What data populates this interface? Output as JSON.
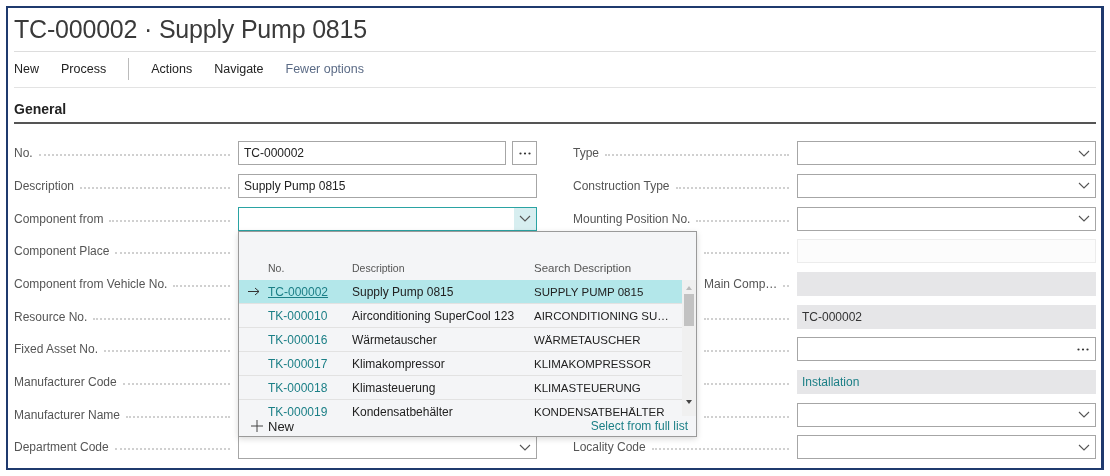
{
  "title": "TC-000002 · Supply Pump 0815",
  "toolbar": [
    {
      "kind": "menu",
      "label": "New"
    },
    {
      "kind": "menu",
      "label": "Process"
    },
    {
      "kind": "separator"
    },
    {
      "kind": "menu",
      "label": "Actions"
    },
    {
      "kind": "menu",
      "label": "Navigate"
    },
    {
      "kind": "toggle",
      "label": "Fewer options"
    }
  ],
  "section": "General",
  "left_fields": [
    {
      "label": "No.",
      "kind": "lookup",
      "value": "TC-000002"
    },
    {
      "label": "Description",
      "kind": "text",
      "value": "Supply Pump 0815"
    },
    {
      "label": "Component from",
      "kind": "select",
      "focused": true
    },
    {
      "label": "Component Place"
    },
    {
      "label": "Component from Vehicle No."
    },
    {
      "label": "Resource No."
    },
    {
      "label": "Fixed Asset No."
    },
    {
      "label": "Manufacturer Code"
    },
    {
      "label": "Manufacturer Name"
    },
    {
      "label": "Department Code",
      "kind": "select",
      "focused": false
    }
  ],
  "right_fields": [
    {
      "label": "Type",
      "kind": "select",
      "focused": false,
      "covered": false
    },
    {
      "label": "Construction Type",
      "kind": "select",
      "focused": false,
      "covered": false
    },
    {
      "label": "Mounting Position No.",
      "kind": "select",
      "focused": false,
      "covered": false
    },
    {
      "kind": "blank",
      "covered": true
    },
    {
      "label": "Main Comp…",
      "kind": "readonly",
      "covered": true
    },
    {
      "kind": "readonly",
      "value": "TC-000002",
      "link": false,
      "covered": true
    },
    {
      "kind": "lookup-inline",
      "covered": true
    },
    {
      "kind": "readonly",
      "value": "Installation",
      "link": true,
      "covered": true
    },
    {
      "kind": "select",
      "focused": false,
      "covered": true
    },
    {
      "label": "Locality Code",
      "kind": "select",
      "focused": false,
      "covered": false
    }
  ],
  "dropdown": {
    "columns": [
      "No.",
      "Description",
      "Search Description"
    ],
    "rows": [
      {
        "no": "TC-000002",
        "description": "Supply Pump 0815",
        "search": "SUPPLY PUMP 0815",
        "selected": true
      },
      {
        "no": "TK-000010",
        "description": "Airconditioning SuperCool 123",
        "search": "AIRCONDITIONING SU…",
        "selected": false
      },
      {
        "no": "TK-000016",
        "description": "Wärmetauscher",
        "search": "WÄRMETAUSCHER",
        "selected": false
      },
      {
        "no": "TK-000017",
        "description": "Klimakompressor",
        "search": "KLIMAKOMPRESSOR",
        "selected": false
      },
      {
        "no": "TK-000018",
        "description": "Klimasteuerung",
        "search": "KLIMASTEUERUNG",
        "selected": false
      },
      {
        "no": "TK-000019",
        "description": "Kondensatbehälter",
        "search": "KONDENSATBEHÄLTER",
        "selected": false
      }
    ],
    "new_label": "New",
    "full_list": "Select from full list"
  }
}
